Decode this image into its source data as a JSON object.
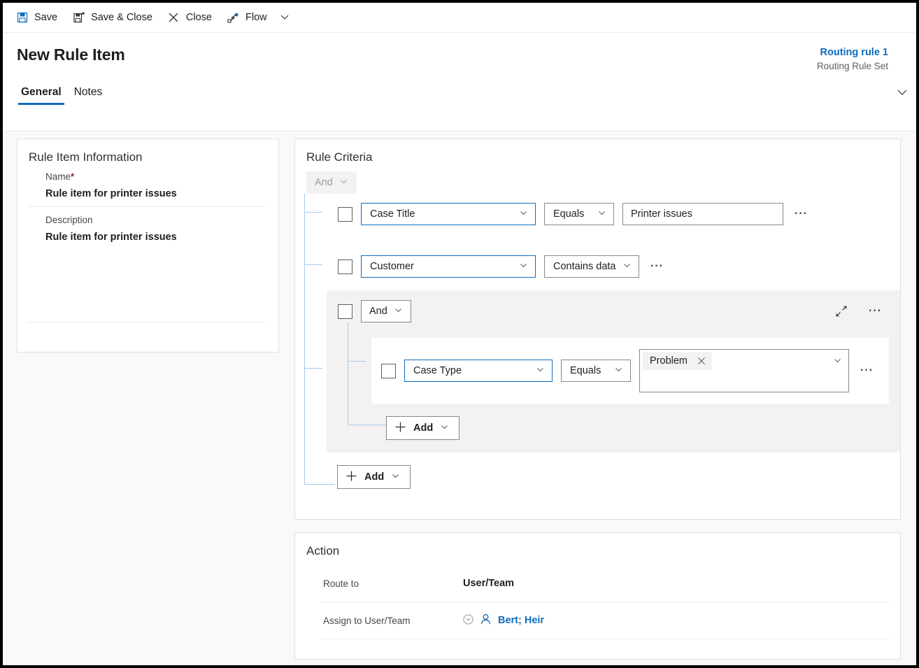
{
  "commandbar": {
    "items": [
      {
        "label": "Save",
        "icon": "save-icon"
      },
      {
        "label": "Save & Close",
        "icon": "save-and-close-icon"
      },
      {
        "label": "Close",
        "icon": "close-x-icon"
      },
      {
        "label": "Flow",
        "icon": "flow-icon"
      }
    ],
    "overflow_icon": "chevron-down-icon"
  },
  "header": {
    "title": "New Rule Item",
    "right_link": "Routing rule 1",
    "right_subtitle": "Routing Rule Set",
    "expand_icon": "chevron-down-icon",
    "tabs": [
      {
        "label": "General",
        "active": true
      },
      {
        "label": "Notes",
        "active": false
      }
    ]
  },
  "rule_item_information": {
    "title": "Rule Item Information",
    "name_label": "Name",
    "name_required_marker": "*",
    "name_value": "Rule item for printer issues",
    "description_label": "Description",
    "description_value": "Rule item for printer issues"
  },
  "rule_criteria": {
    "title": "Rule Criteria",
    "root_operator": {
      "label": "And",
      "disabled": true
    },
    "rows": [
      {
        "field": "Case Title",
        "operator": "Equals",
        "value": "Printer issues",
        "more_icon": "more-options-icon"
      },
      {
        "field": "Customer",
        "operator": "Contains data",
        "value": null,
        "more_icon": "more-options-icon"
      }
    ],
    "group": {
      "operator": "And",
      "collapse_icon": "collapse-icon",
      "more_icon": "more-options-icon",
      "rows": [
        {
          "field": "Case Type",
          "operator": "Equals",
          "chip": "Problem",
          "chip_remove_icon": "close-x-icon",
          "more_icon": "more-options-icon"
        }
      ],
      "add_label": "Add"
    },
    "add_label": "Add"
  },
  "action": {
    "title": "Action",
    "route_to_label": "Route to",
    "route_to_value": "User/Team",
    "assign_label": "Assign to User/Team",
    "assign_value": "Bert; Heir",
    "assign_lookup_icon": "lookup-circle-icon",
    "assign_person_icon": "person-icon"
  },
  "colors": {
    "accent": "#0f6cbd",
    "tree_line": "#a6c8f0",
    "required": "#a4262c",
    "group_bg": "#f3f2f1"
  }
}
